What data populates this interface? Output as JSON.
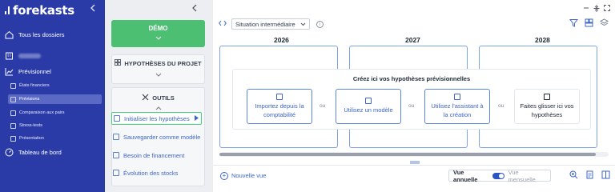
{
  "app": {
    "logo_text": "forekasts",
    "collapse_icon": "chevron-left-icon"
  },
  "sidebar": {
    "all_folders": "Tous les dossiers",
    "previsionnel": "Prévisionnel",
    "sub_items": [
      {
        "label": "États financiers",
        "icon": "document-icon",
        "active": false
      },
      {
        "label": "Prévisions",
        "icon": "chart-icon",
        "active": true
      },
      {
        "label": "Comparaison aux pairs",
        "icon": "compare-icon",
        "active": false
      },
      {
        "label": "Stress-tests",
        "icon": "pulse-icon",
        "active": false
      },
      {
        "label": "Présentation",
        "icon": "presentation-icon",
        "active": false
      }
    ],
    "dashboard": "Tableau de bord"
  },
  "middle": {
    "demo_label": "DÉMO",
    "hypotheses_title": "HYPOTHÈSES DU PROJET",
    "outils_title": "OUTILS",
    "tools": [
      {
        "label": "Initialiser les hypothèses",
        "selected": true
      },
      {
        "label": "Sauvegarder comme modèle",
        "selected": false
      },
      {
        "label": "Besoin de financement",
        "selected": false
      },
      {
        "label": "Évolution des stocks",
        "selected": false
      }
    ]
  },
  "main": {
    "scenario_value": "Situation intermédiaire",
    "years": [
      "2026",
      "2027",
      "2028"
    ],
    "overlay_title": "Créez ici vos hypothèses prévisionnelles",
    "options": [
      {
        "label_1": "Importez depuis la",
        "label_2": "comptabilité"
      },
      {
        "label_1": "Utilisez un modèle",
        "label_2": ""
      },
      {
        "label_1": "Utilisez l'assistant à",
        "label_2": "la création"
      },
      {
        "label_1": "Faites glisser ici vos",
        "label_2": "hypothèses"
      }
    ],
    "separator": "ou",
    "new_view": "Nouvelle vue",
    "view_annual": "Vue annuelle",
    "view_monthly": "Vue mensuelle"
  },
  "colors": {
    "sidebar_bg": "#2a3ba8",
    "demo_green": "#4cbf73",
    "accent_blue": "#3d64c8",
    "selection_green": "#44d17a"
  }
}
